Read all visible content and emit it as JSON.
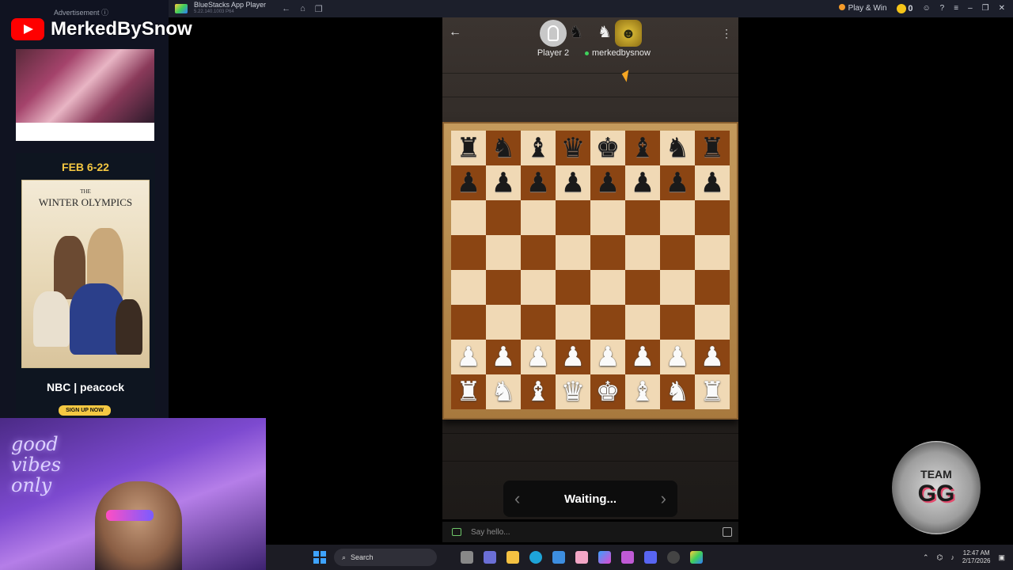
{
  "titlebar": {
    "app_name": "BlueStacks App Player",
    "app_version": "5.22.140.1003 P64",
    "play_win_label": "Play & Win",
    "coin_count": "0"
  },
  "ad": {
    "label": "Advertisement ⓘ",
    "feb_dates": "FEB 6-22",
    "olympics_title_small": "THE",
    "olympics_title": "WINTER OLYMPICS",
    "network": "NBC | peacock",
    "cta": "SIGN UP NOW"
  },
  "stream": {
    "channel_name": "MerkedBySnow",
    "neon_sign": "good vibes only",
    "team_badge_top": "TEAM",
    "team_badge_main": "GG"
  },
  "game": {
    "player2_name": "Player 2",
    "player1_name": "merkedbysnow",
    "status": "Waiting...",
    "chat_placeholder": "Say hello..."
  },
  "board": {
    "rows": [
      [
        "♜",
        "♞",
        "♝",
        "♛",
        "♚",
        "♝",
        "♞",
        "♜"
      ],
      [
        "♟",
        "♟",
        "♟",
        "♟",
        "♟",
        "♟",
        "♟",
        "♟"
      ],
      [
        "",
        "",
        "",
        "",
        "",
        "",
        "",
        ""
      ],
      [
        "",
        "",
        "",
        "",
        "",
        "",
        "",
        ""
      ],
      [
        "",
        "",
        "",
        "",
        "",
        "",
        "",
        ""
      ],
      [
        "",
        "",
        "",
        "",
        "",
        "",
        "",
        ""
      ],
      [
        "♟",
        "♟",
        "♟",
        "♟",
        "♟",
        "♟",
        "♟",
        "♟"
      ],
      [
        "♜",
        "♞",
        "♝",
        "♛",
        "♚",
        "♝",
        "♞",
        "♜"
      ]
    ],
    "piece_colors": [
      "black",
      "black",
      "none",
      "none",
      "none",
      "none",
      "white",
      "white"
    ]
  },
  "taskbar": {
    "search_label": "Search",
    "time": "12:47 AM",
    "date": "2/17/2026"
  },
  "colors": {
    "board_light": "#f0d9b5",
    "board_dark": "#8b4513",
    "accent": "#3ea3ff"
  }
}
